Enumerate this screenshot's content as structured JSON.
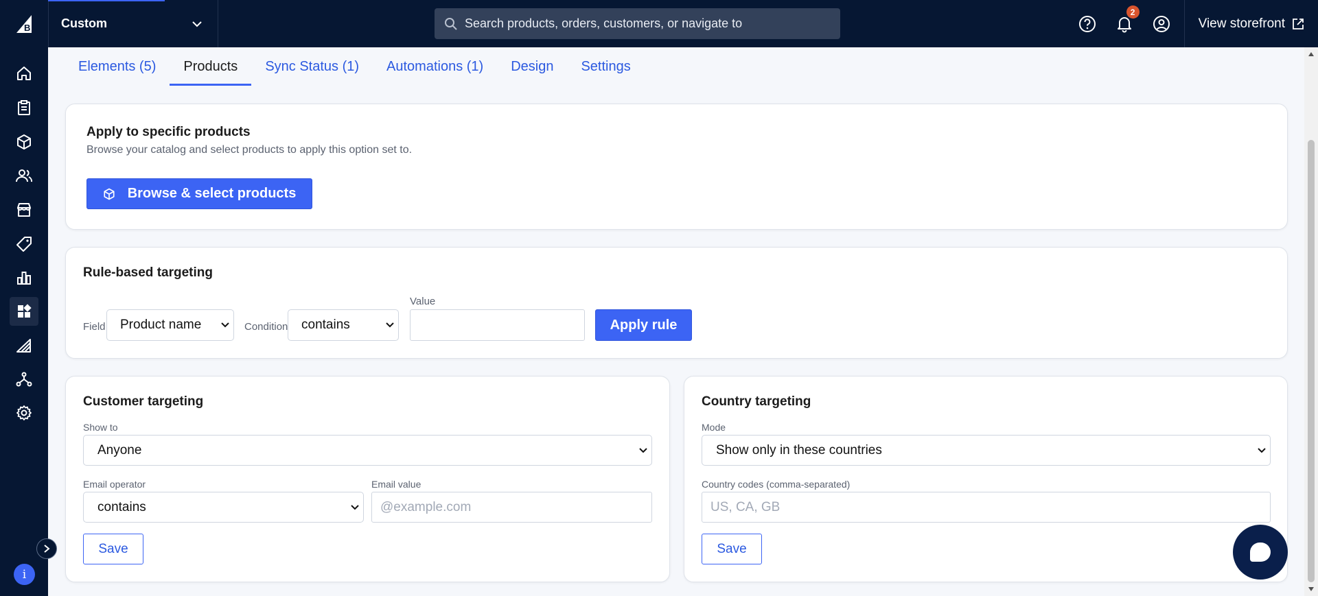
{
  "header": {
    "store_name": "Custom",
    "search_placeholder": "Search products, orders, customers, or navigate to",
    "notification_count": "2",
    "view_storefront": "View storefront"
  },
  "sidebar": {
    "items": [
      {
        "name": "home-icon"
      },
      {
        "name": "orders-icon"
      },
      {
        "name": "products-icon"
      },
      {
        "name": "customers-icon"
      },
      {
        "name": "storefront-icon"
      },
      {
        "name": "marketing-icon"
      },
      {
        "name": "analytics-icon"
      },
      {
        "name": "apps-icon",
        "active": true
      },
      {
        "name": "channel-manager-icon"
      },
      {
        "name": "integrations-icon"
      },
      {
        "name": "settings-icon"
      }
    ],
    "info_label": "i"
  },
  "tabs": [
    {
      "label": "Elements (5)"
    },
    {
      "label": "Products",
      "active": true
    },
    {
      "label": "Sync Status (1)"
    },
    {
      "label": "Automations (1)"
    },
    {
      "label": "Design"
    },
    {
      "label": "Settings"
    }
  ],
  "apply_products": {
    "title": "Apply to specific products",
    "subtitle": "Browse your catalog and select products to apply this option set to.",
    "button": "Browse & select products"
  },
  "rule_targeting": {
    "title": "Rule-based targeting",
    "field_label": "Field",
    "field_value": "Product name",
    "condition_label": "Condition",
    "condition_value": "contains",
    "value_label": "Value",
    "value_input": "",
    "button": "Apply rule"
  },
  "customer_targeting": {
    "title": "Customer targeting",
    "show_to_label": "Show to",
    "show_to_value": "Anyone",
    "email_operator_label": "Email operator",
    "email_operator_value": "contains",
    "email_value_label": "Email value",
    "email_value_placeholder": "@example.com",
    "save": "Save"
  },
  "country_targeting": {
    "title": "Country targeting",
    "mode_label": "Mode",
    "mode_value": "Show only in these countries",
    "codes_label": "Country codes (comma-separated)",
    "codes_placeholder": "US, CA, GB",
    "save": "Save"
  },
  "colors": {
    "nav_bg": "#061733",
    "accent": "#3c64f4",
    "badge": "#d9552e"
  }
}
